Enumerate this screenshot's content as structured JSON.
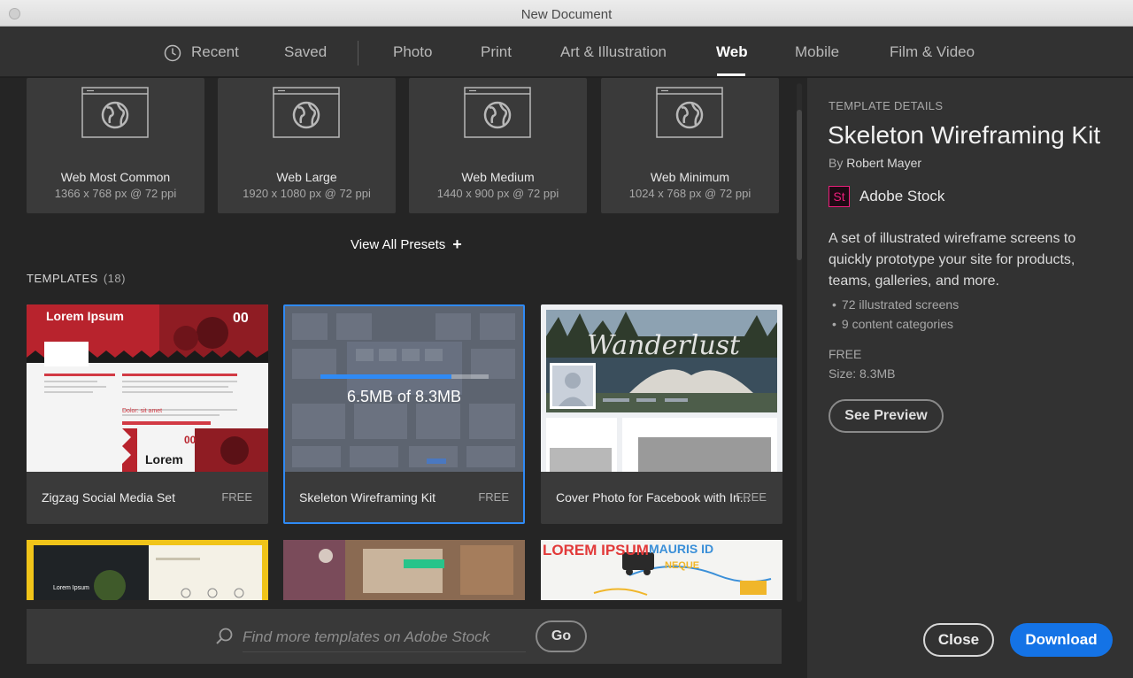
{
  "window": {
    "title": "New Document"
  },
  "tabs": [
    {
      "label": "Recent"
    },
    {
      "label": "Saved"
    },
    {
      "label": "Photo"
    },
    {
      "label": "Print"
    },
    {
      "label": "Art & Illustration"
    },
    {
      "label": "Web",
      "active": true
    },
    {
      "label": "Mobile"
    },
    {
      "label": "Film & Video"
    }
  ],
  "presets": [
    {
      "name": "Web Most Common",
      "size": "1366 x 768 px @ 72 ppi"
    },
    {
      "name": "Web Large",
      "size": "1920 x 1080 px @ 72 ppi"
    },
    {
      "name": "Web Medium",
      "size": "1440 x 900 px @ 72 ppi"
    },
    {
      "name": "Web Minimum",
      "size": "1024 x 768 px @ 72 ppi"
    }
  ],
  "view_all": {
    "label": "View All Presets",
    "icon": "plus-icon"
  },
  "templates": {
    "header": "TEMPLATES",
    "count": "(18)",
    "cards": [
      {
        "name": "Zigzag Social Media Set",
        "price": "FREE",
        "thumb_text_1": "Lorem Ipsum",
        "thumb_text_2": "Lorem",
        "thumb_text_3": "Dolor: sit amet",
        "thumb_badge": "00"
      },
      {
        "name": "Skeleton Wireframing Kit",
        "price": "FREE",
        "selected": true
      },
      {
        "name": "Cover Photo for Facebook with In...",
        "price": "FREE",
        "thumb_text": "Wanderlust"
      }
    ],
    "row2": [
      {
        "thumb_text": "Lorem Ipsum"
      },
      {
        "thumb_text": ""
      },
      {
        "thumb_text": "LOREM IPSUM",
        "thumb_text_2": "MAURIS ID",
        "thumb_text_3": "NEQUE"
      }
    ]
  },
  "download_progress": {
    "text": "6.5MB of 8.3MB",
    "fraction": 0.78
  },
  "search": {
    "placeholder": "Find more templates on Adobe Stock",
    "value": "",
    "go_label": "Go"
  },
  "details": {
    "section_label": "TEMPLATE DETAILS",
    "title": "Skeleton Wireframing Kit",
    "by_prefix": "By",
    "author": "Robert Mayer",
    "source_logo": "St",
    "source_name": "Adobe Stock",
    "description": "A set of illustrated wireframe screens to quickly prototype your site for products, teams, galleries, and more.",
    "bullets": [
      "72 illustrated screens",
      "9 content categories"
    ],
    "price": "FREE",
    "size": "Size: 8.3MB",
    "preview_label": "See Preview"
  },
  "footer": {
    "close_label": "Close",
    "download_label": "Download"
  },
  "colors": {
    "accent": "#1473e6",
    "selection": "#2f8af5",
    "stock_pink": "#ec1e7b"
  }
}
